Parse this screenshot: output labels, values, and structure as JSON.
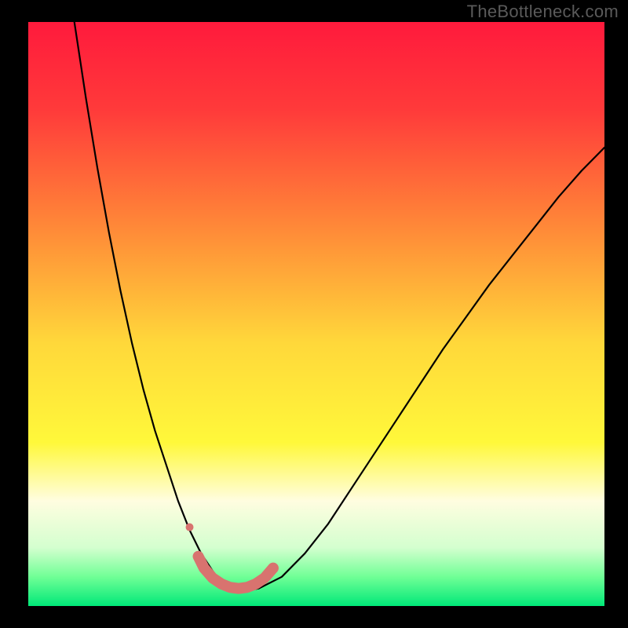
{
  "watermark": "TheBottleneck.com",
  "chart_data": {
    "type": "line",
    "title": "",
    "xlabel": "",
    "ylabel": "",
    "xlim": [
      0,
      100
    ],
    "ylim": [
      0,
      100
    ],
    "background_gradient": {
      "stops": [
        {
          "offset": 0.0,
          "color": "#ff1a3c"
        },
        {
          "offset": 0.15,
          "color": "#ff3a3a"
        },
        {
          "offset": 0.35,
          "color": "#ff8838"
        },
        {
          "offset": 0.55,
          "color": "#ffd83a"
        },
        {
          "offset": 0.72,
          "color": "#fff83a"
        },
        {
          "offset": 0.82,
          "color": "#fffde0"
        },
        {
          "offset": 0.9,
          "color": "#d4ffcf"
        },
        {
          "offset": 0.95,
          "color": "#70ff96"
        },
        {
          "offset": 1.0,
          "color": "#00e878"
        }
      ]
    },
    "series": [
      {
        "name": "curve",
        "color": "#000000",
        "stroke_width": 2.2,
        "x": [
          8,
          10,
          12,
          14,
          16,
          18,
          20,
          22,
          24,
          26,
          28,
          30,
          32,
          33.5,
          35,
          37,
          40,
          44,
          48,
          52,
          56,
          60,
          64,
          68,
          72,
          76,
          80,
          84,
          88,
          92,
          96,
          100
        ],
        "y": [
          100,
          87,
          75,
          64,
          54,
          45,
          37,
          30,
          24,
          18,
          13,
          9,
          6,
          4,
          3,
          2.5,
          3,
          5,
          9,
          14,
          20,
          26,
          32,
          38,
          44,
          49.5,
          55,
          60,
          65,
          70,
          74.5,
          78.5
        ]
      },
      {
        "name": "bottom-highlight",
        "color": "#d8736f",
        "stroke_width": 14,
        "x": [
          29.5,
          30.5,
          32,
          33.5,
          35,
          36.5,
          38,
          39.5,
          41,
          42.5
        ],
        "y": [
          8.5,
          6.5,
          4.8,
          3.8,
          3.2,
          3.0,
          3.2,
          3.8,
          4.8,
          6.5
        ]
      },
      {
        "name": "left-dot",
        "color": "#d8736f",
        "type_override": "scatter",
        "x": [
          28
        ],
        "y": [
          13.5
        ],
        "r": 5
      }
    ]
  }
}
